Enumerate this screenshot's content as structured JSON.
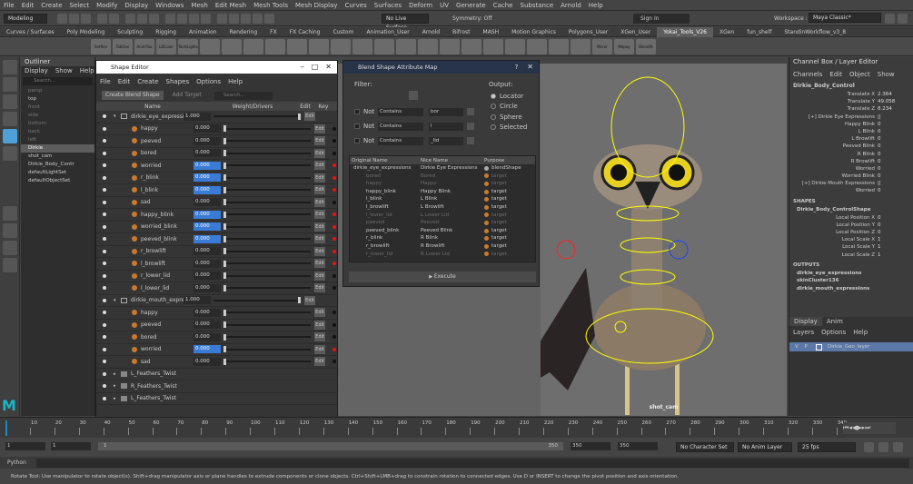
{
  "menubar": [
    "File",
    "Edit",
    "Create",
    "Select",
    "Modify",
    "Display",
    "Windows",
    "Mesh",
    "Edit Mesh",
    "Mesh Tools",
    "Mesh Display",
    "Curves",
    "Surfaces",
    "Deform",
    "UV",
    "Generate",
    "Cache",
    "Substance",
    "Arnold",
    "Help"
  ],
  "workspace": {
    "label": "Workspace :",
    "value": "Maya Classic*"
  },
  "status": {
    "mode": "Modeling",
    "live_surface": "No Live Surface",
    "symmetry": "Symmetry: Off",
    "sign_in": "Sign In"
  },
  "shelf_tabs": [
    "Curves / Surfaces",
    "Poly Modeling",
    "Sculpting",
    "Rigging",
    "Animation",
    "Rendering",
    "FX",
    "FX Caching",
    "Custom",
    "Animation_User",
    "Arnold",
    "Bifrost",
    "MASH",
    "Motion Graphics",
    "Polygons_User",
    "XGen_User",
    "Yokai_Tools_V26",
    "XGen",
    "fun_shelf",
    "StandinWorkflow_v3_8"
  ],
  "shelf_active": "Yokai_Tools_V26",
  "shelf_icons": [
    "SetRev",
    "TabOve",
    "AnimToo",
    "LDColor",
    "ToolsLightsAO",
    "",
    "",
    "",
    "",
    "",
    "",
    "",
    "",
    "",
    "",
    "",
    "",
    "",
    "",
    "",
    "",
    "",
    "",
    "Mirror",
    "Mapay",
    "BlendAt"
  ],
  "outliner": {
    "title": "Outliner",
    "menu": [
      "Display",
      "Show",
      "Help"
    ],
    "search_placeholder": "Search...",
    "items": [
      {
        "label": "persp",
        "dim": true
      },
      {
        "label": "top",
        "dim": false
      },
      {
        "label": "front",
        "dim": true
      },
      {
        "label": "side",
        "dim": true
      },
      {
        "label": "bottom",
        "dim": true
      },
      {
        "label": "back",
        "dim": true
      },
      {
        "label": "left",
        "dim": true
      },
      {
        "label": "Dirkie",
        "dim": false,
        "hl": true
      },
      {
        "label": "shot_cam",
        "dim": false
      },
      {
        "label": "Dirkie_Body_Contr",
        "dim": false
      },
      {
        "label": "defaultLightSet",
        "dim": false
      },
      {
        "label": "defaultObjectSet",
        "dim": false
      }
    ]
  },
  "shape_editor": {
    "title": "Shape Editor",
    "menu": [
      "File",
      "Edit",
      "Create",
      "Shapes",
      "Options",
      "Help"
    ],
    "create_btn": "Create Blend Shape",
    "add_target_btn": "Add Target",
    "search_placeholder": "Search...",
    "columns": {
      "name": "Name",
      "weight": "Weight/Drivers",
      "edit": "Edit",
      "key": "Key"
    },
    "edit_label": "Edit",
    "rows": [
      {
        "type": "group",
        "label": "dirkie_eye_expressio",
        "value": "1.000",
        "slider": 1.0
      },
      {
        "type": "target",
        "label": "happy",
        "value": "0.000",
        "blue": false,
        "key": false
      },
      {
        "type": "target",
        "label": "peeved",
        "value": "0.000",
        "blue": false,
        "key": false
      },
      {
        "type": "target",
        "label": "bored",
        "value": "0.000",
        "blue": false,
        "key": false
      },
      {
        "type": "target",
        "label": "worried",
        "value": "0.000",
        "blue": true,
        "key": true
      },
      {
        "type": "target",
        "label": "r_blink",
        "value": "0.000",
        "blue": true,
        "key": true
      },
      {
        "type": "target",
        "label": "l_blink",
        "value": "0.000",
        "blue": true,
        "key": true
      },
      {
        "type": "target",
        "label": "sad",
        "value": "0.000",
        "blue": false,
        "key": false
      },
      {
        "type": "target",
        "label": "happy_blink",
        "value": "0.000",
        "blue": true,
        "key": true
      },
      {
        "type": "target",
        "label": "worried_blink",
        "value": "0.000",
        "blue": true,
        "key": true
      },
      {
        "type": "target",
        "label": "peeved_blink",
        "value": "0.000",
        "blue": true,
        "key": true
      },
      {
        "type": "target",
        "label": "r_browlift",
        "value": "0.000",
        "blue": false,
        "key": true
      },
      {
        "type": "target",
        "label": "l_browlift",
        "value": "0.000",
        "blue": false,
        "key": true
      },
      {
        "type": "target",
        "label": "r_lower_lid",
        "value": "0.000",
        "blue": false,
        "key": false
      },
      {
        "type": "target",
        "label": "l_lower_lid",
        "value": "0.000",
        "blue": false,
        "key": false
      },
      {
        "type": "group",
        "label": "dirkie_mouth_expre",
        "value": "1.000",
        "slider": 1.0
      },
      {
        "type": "target",
        "label": "happy",
        "value": "0.000",
        "blue": false,
        "key": false
      },
      {
        "type": "target",
        "label": "peeved",
        "value": "0.000",
        "blue": false,
        "key": false
      },
      {
        "type": "target",
        "label": "bored",
        "value": "0.000",
        "blue": false,
        "key": false
      },
      {
        "type": "target",
        "label": "worried",
        "value": "0.000",
        "blue": true,
        "key": true
      },
      {
        "type": "target",
        "label": "sad",
        "value": "0.000",
        "blue": false,
        "key": false
      },
      {
        "type": "folder",
        "label": "L_Feathers_Twist"
      },
      {
        "type": "folder",
        "label": "R_Feathers_Twist"
      },
      {
        "type": "folder",
        "label": "L_Feathers_Twist"
      }
    ]
  },
  "blend_map": {
    "title": "Blend Shape Attribute Map",
    "filter_label": "Filter:",
    "output_label": "Output:",
    "filters": [
      {
        "not": "Not",
        "cond": "Contains",
        "value": "bor"
      },
      {
        "not": "Not",
        "cond": "Contains",
        "value": "l"
      },
      {
        "not": "Not",
        "cond": "Contains",
        "value": "_lid"
      }
    ],
    "outputs": [
      "Locator",
      "Circle",
      "Sphere",
      "Selected"
    ],
    "columns": [
      "Original Name",
      "Nice Name",
      "Purpose"
    ],
    "rows": [
      {
        "orig": "dirkie_eye_expressions",
        "nice": "Dirkie Eye Expressions",
        "purpose": "blendShape",
        "dim": false,
        "group": true
      },
      {
        "orig": "bored",
        "nice": "Bored",
        "purpose": "target",
        "dim": true
      },
      {
        "orig": "happy",
        "nice": "Happy",
        "purpose": "target",
        "dim": true
      },
      {
        "orig": "happy_blink",
        "nice": "Happy Blink",
        "purpose": "target",
        "dim": false
      },
      {
        "orig": "l_blink",
        "nice": "L Blink",
        "purpose": "target",
        "dim": false
      },
      {
        "orig": "l_browlift",
        "nice": "L Browlift",
        "purpose": "target",
        "dim": false
      },
      {
        "orig": "l_lower_lid",
        "nice": "L Lower Lid",
        "purpose": "target",
        "dim": true
      },
      {
        "orig": "peeved",
        "nice": "Peeved",
        "purpose": "target",
        "dim": true
      },
      {
        "orig": "peeved_blink",
        "nice": "Peeved Blink",
        "purpose": "target",
        "dim": false
      },
      {
        "orig": "r_blink",
        "nice": "R Blink",
        "purpose": "target",
        "dim": false
      },
      {
        "orig": "r_browlift",
        "nice": "R Browlift",
        "purpose": "target",
        "dim": false
      },
      {
        "orig": "r_lower_lid",
        "nice": "R Lower Lid",
        "purpose": "target",
        "dim": true
      }
    ],
    "execute_label": "Execute"
  },
  "viewport": {
    "camera_label": "shot_cam",
    "dropdown": "Dma"
  },
  "channel_box": {
    "title": "Channel Box / Layer Editor",
    "menu": [
      "Channels",
      "Edit",
      "Object",
      "Show"
    ],
    "object": "Dirkie_Body_Control",
    "channels": [
      {
        "label": "Translate X",
        "value": "2.364"
      },
      {
        "label": "Translate Y",
        "value": "49.058"
      },
      {
        "label": "Translate Z",
        "value": "8.234"
      },
      {
        "label": "[+] Dirkie Eye Expressions",
        "value": "||"
      },
      {
        "label": "Happy Blink",
        "value": "0"
      },
      {
        "label": "L Blink",
        "value": "0"
      },
      {
        "label": "L Browlift",
        "value": "0"
      },
      {
        "label": "Peeved Blink",
        "value": "0"
      },
      {
        "label": "R Blink",
        "value": "0"
      },
      {
        "label": "R Browlift",
        "value": "0"
      },
      {
        "label": "Worried",
        "value": "0"
      },
      {
        "label": "Worried Blink",
        "value": "0"
      },
      {
        "label": "[+] Dirkie Mouth Expressions",
        "value": "||"
      },
      {
        "label": "Worried",
        "value": "0"
      }
    ],
    "shapes_header": "SHAPES",
    "shape_node": "Dirkie_Body_ControlShape",
    "shape_channels": [
      {
        "label": "Local Position X",
        "value": "0"
      },
      {
        "label": "Local Position Y",
        "value": "0"
      },
      {
        "label": "Local Position Z",
        "value": "0"
      },
      {
        "label": "Local Scale X",
        "value": "1"
      },
      {
        "label": "Local Scale Y",
        "value": "1"
      },
      {
        "label": "Local Scale Z",
        "value": "1"
      }
    ],
    "outputs_header": "OUTPUTS",
    "outputs": [
      "dirkie_eye_expressions",
      "skinCluster136",
      "dirkie_mouth_expressions"
    ],
    "layer_tabs": [
      "Display",
      "Anim"
    ],
    "layer_menu": [
      "Layers",
      "Options",
      "Help"
    ],
    "layer": {
      "v": "V",
      "p": "P",
      "name": "Dirkie_Geo_layer"
    }
  },
  "timeline": {
    "ticks": [
      "10",
      "20",
      "30",
      "40",
      "50",
      "60",
      "70",
      "80",
      "90",
      "100",
      "110",
      "120",
      "130",
      "140",
      "150",
      "160",
      "170",
      "180",
      "190",
      "200",
      "210",
      "220",
      "230",
      "240",
      "250",
      "260",
      "270",
      "280",
      "290",
      "300",
      "310",
      "320",
      "330",
      "340"
    ],
    "current_frame": "1"
  },
  "range": {
    "start": "1",
    "start2": "1",
    "slider_start": "1",
    "slider_end": "350",
    "end": "350",
    "end2": "350",
    "character": "No Character Set",
    "anim_layer": "No Anim Layer",
    "fps": "25 fps"
  },
  "cmdline": {
    "label": "Python"
  },
  "help": "Rotate Tool: Use manipulator to rotate object(s). Shift+drag manipulator axis or plane handles to extrude components or clone objects. Ctrl+Shift+LMB+drag to constrain rotation to connected edges. Use D or INSERT to change the pivot position and axis orientation."
}
